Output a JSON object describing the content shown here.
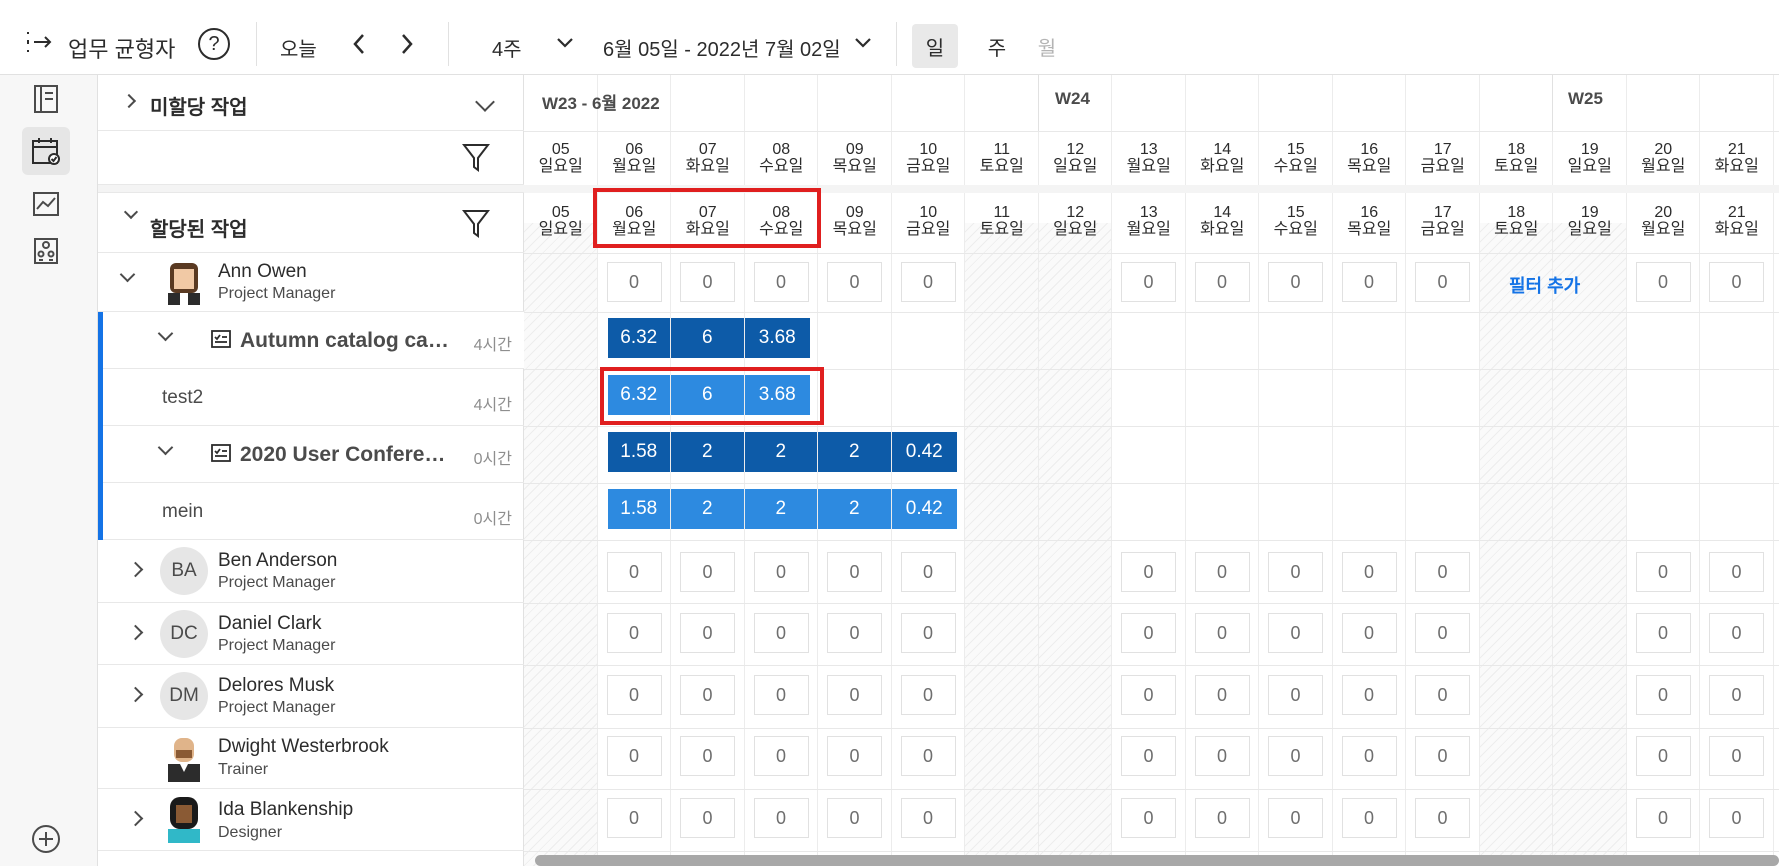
{
  "toolbar": {
    "title": "업무 균형자",
    "today": "오늘",
    "weeks": "4주",
    "date_range": "6월 05일 - 2022년 7월 02일",
    "view_day": "일",
    "view_week": "주",
    "view_month": "월"
  },
  "left_panel": {
    "unassigned_title": "미할당 작업",
    "assigned_title": "할당된 작업",
    "people": [
      {
        "name": "Ann Owen",
        "role": "Project Manager"
      },
      {
        "name": "Ben  Anderson",
        "role": "Project Manager",
        "initials": "BA"
      },
      {
        "name": "Daniel Clark",
        "role": "Project Manager",
        "initials": "DC"
      },
      {
        "name": "Delores Musk",
        "role": "Project Manager",
        "initials": "DM"
      },
      {
        "name": "Dwight Westerbrook",
        "role": "Trainer"
      },
      {
        "name": "Ida Blankenship",
        "role": "Designer"
      }
    ],
    "projects": [
      {
        "name": "Autumn catalog ca…",
        "hours": "4시간",
        "task": "test2",
        "task_hours": "4시간"
      },
      {
        "name": "2020 User Confere…",
        "hours": "0시간",
        "task": "mein",
        "task_hours": "0시간"
      }
    ]
  },
  "grid": {
    "weeks": [
      "W23 - 6월 2022",
      "W24",
      "W25"
    ],
    "days": [
      {
        "num": "05",
        "wd": "일요일"
      },
      {
        "num": "06",
        "wd": "월요일"
      },
      {
        "num": "07",
        "wd": "화요일"
      },
      {
        "num": "08",
        "wd": "수요일"
      },
      {
        "num": "09",
        "wd": "목요일"
      },
      {
        "num": "10",
        "wd": "금요일"
      },
      {
        "num": "11",
        "wd": "토요일"
      },
      {
        "num": "12",
        "wd": "일요일"
      },
      {
        "num": "13",
        "wd": "월요일"
      },
      {
        "num": "14",
        "wd": "화요일"
      },
      {
        "num": "15",
        "wd": "수요일"
      },
      {
        "num": "16",
        "wd": "목요일"
      },
      {
        "num": "17",
        "wd": "금요일"
      },
      {
        "num": "18",
        "wd": "토요일"
      },
      {
        "num": "19",
        "wd": "일요일"
      },
      {
        "num": "20",
        "wd": "월요일"
      },
      {
        "num": "21",
        "wd": "화요일"
      }
    ],
    "add_filter": "필터 추가",
    "zero": "0",
    "autumn_values": [
      "6.32",
      "6",
      "3.68"
    ],
    "conf_values": [
      "1.58",
      "2",
      "2",
      "2",
      "0.42"
    ]
  },
  "colors": {
    "accent": "#1473e6",
    "alloc_dark": "#0d5ba8",
    "alloc_light": "#2d8ae0",
    "highlight": "#e01f1f"
  }
}
